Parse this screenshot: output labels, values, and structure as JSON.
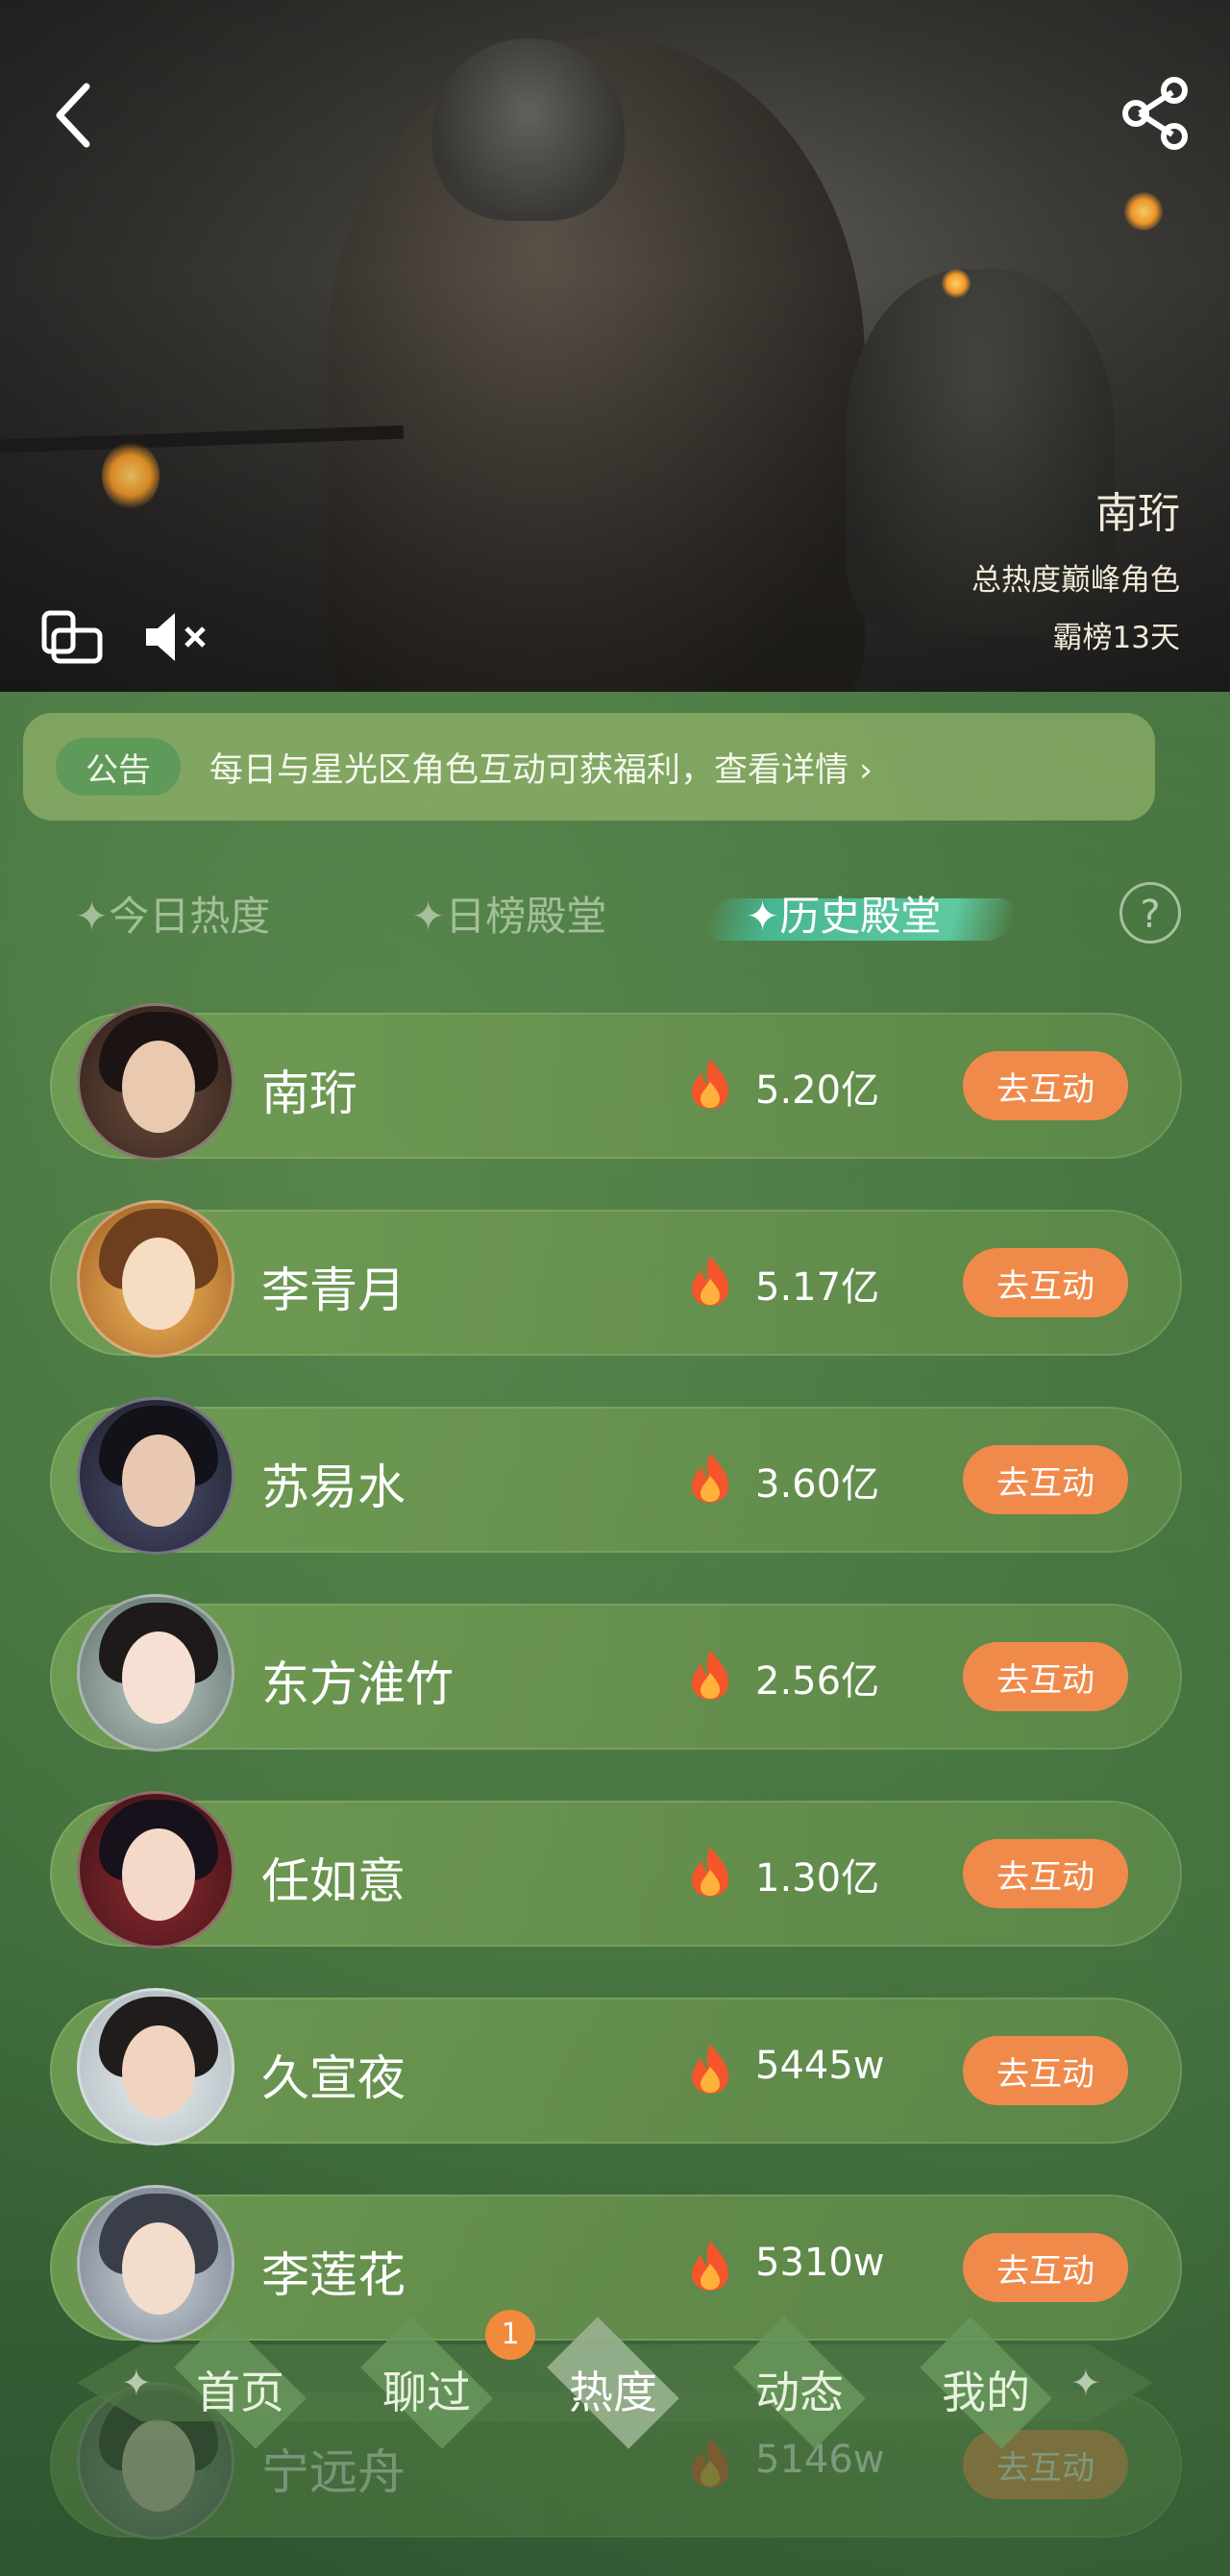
{
  "hero": {
    "character_name": "南珩",
    "subtitle": "总热度巅峰角色",
    "days_label": "霸榜13天"
  },
  "notice": {
    "tag": "公告",
    "text": "每日与星光区角色互动可获福利，查看详情 ›"
  },
  "tabs": [
    {
      "label": "✦今日热度"
    },
    {
      "label": "✦日榜殿堂"
    },
    {
      "label": "✦历史殿堂"
    }
  ],
  "help_label": "?",
  "ranking": [
    {
      "name": "南珩",
      "heat": "5.20亿",
      "button": "去互动"
    },
    {
      "name": "李青月",
      "heat": "5.17亿",
      "button": "去互动"
    },
    {
      "name": "苏易水",
      "heat": "3.60亿",
      "button": "去互动"
    },
    {
      "name": "东方淮竹",
      "heat": "2.56亿",
      "button": "去互动"
    },
    {
      "name": "任如意",
      "heat": "1.30亿",
      "button": "去互动"
    },
    {
      "name": "久宣夜",
      "heat": "5445w",
      "button": "去互动"
    },
    {
      "name": "李莲花",
      "heat": "5310w",
      "button": "去互动"
    },
    {
      "name": "宁远舟",
      "heat": "5146w",
      "button": "去互动"
    }
  ],
  "bottom_nav": {
    "items": [
      {
        "label": "首页"
      },
      {
        "label": "聊过"
      },
      {
        "label": "热度"
      },
      {
        "label": "动态"
      },
      {
        "label": "我的"
      }
    ],
    "badge": "1",
    "spark": "✦"
  },
  "colors": {
    "accent_button": "#f08a4b",
    "active_tab_brush": "#4fbf98",
    "badge": "#f28a3c",
    "background": "#46733f"
  }
}
